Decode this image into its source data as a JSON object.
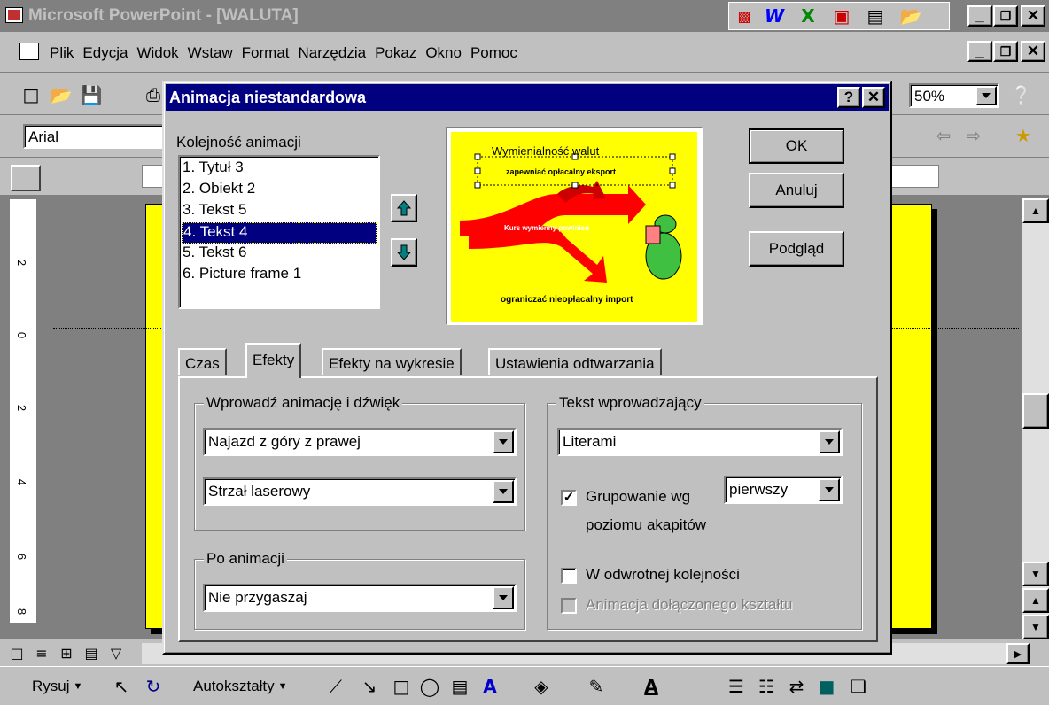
{
  "app": {
    "title": "Microsoft PowerPoint - [WALUTA]",
    "window_controls": [
      "_",
      "□",
      "✕"
    ]
  },
  "menubar": {
    "items": [
      "Plik",
      "Edycja",
      "Widok",
      "Wstaw",
      "Format",
      "Narzędzia",
      "Pokaz",
      "Okno",
      "Pomoc"
    ]
  },
  "toolbar": {
    "zoom": "50%",
    "font": "Arial"
  },
  "dialog": {
    "title": "Animacja niestandardowa",
    "order_label": "Kolejność animacji",
    "order_items": [
      "1. Tytuł 3",
      "2. Obiekt 2",
      "3. Tekst 5",
      "4. Tekst 4",
      "5. Tekst 6",
      "6. Picture frame 1"
    ],
    "selected_index": 3,
    "buttons": {
      "ok": "OK",
      "cancel": "Anuluj",
      "preview": "Podgląd"
    },
    "slide_preview": {
      "title": "Wymienialność walut",
      "line1": "zapewniać opłacalny eksport",
      "arrow_text": "Kurs wymienny powinien",
      "line2": "ograniczać nieopłacalny import"
    },
    "tabs": [
      "Czas",
      "Efekty",
      "Efekty na wykresie",
      "Ustawienia odtwarzania"
    ],
    "active_tab": "Efekty",
    "group_enter": {
      "label": "Wprowadź animację i dźwięk",
      "effect": "Najazd z góry z prawej",
      "sound": "Strzał laserowy"
    },
    "group_after": {
      "label": "Po animacji",
      "value": "Nie przygaszaj"
    },
    "group_text": {
      "label": "Tekst wprowadzający",
      "value": "Literami",
      "group_by_label_1": "Grupowanie wg",
      "group_by_label_2": "poziomu akapitów",
      "group_by_value": "pierwszy",
      "group_by_checked": true,
      "reverse_label": "W odwrotnej kolejności",
      "reverse_checked": false,
      "attached_label": "Animacja dołączonego kształtu",
      "attached_checked": false
    }
  },
  "drawing_toolbar": {
    "draw": "Rysuj",
    "autoshapes": "Autokształty"
  },
  "ruler_numbers": [
    "2",
    "0",
    "2",
    "4",
    "6",
    "8"
  ],
  "colors": {
    "titlebar": "#000080",
    "inactive_titlebar": "#808080",
    "slide": "#ffff00",
    "arrow": "#ff0000"
  }
}
